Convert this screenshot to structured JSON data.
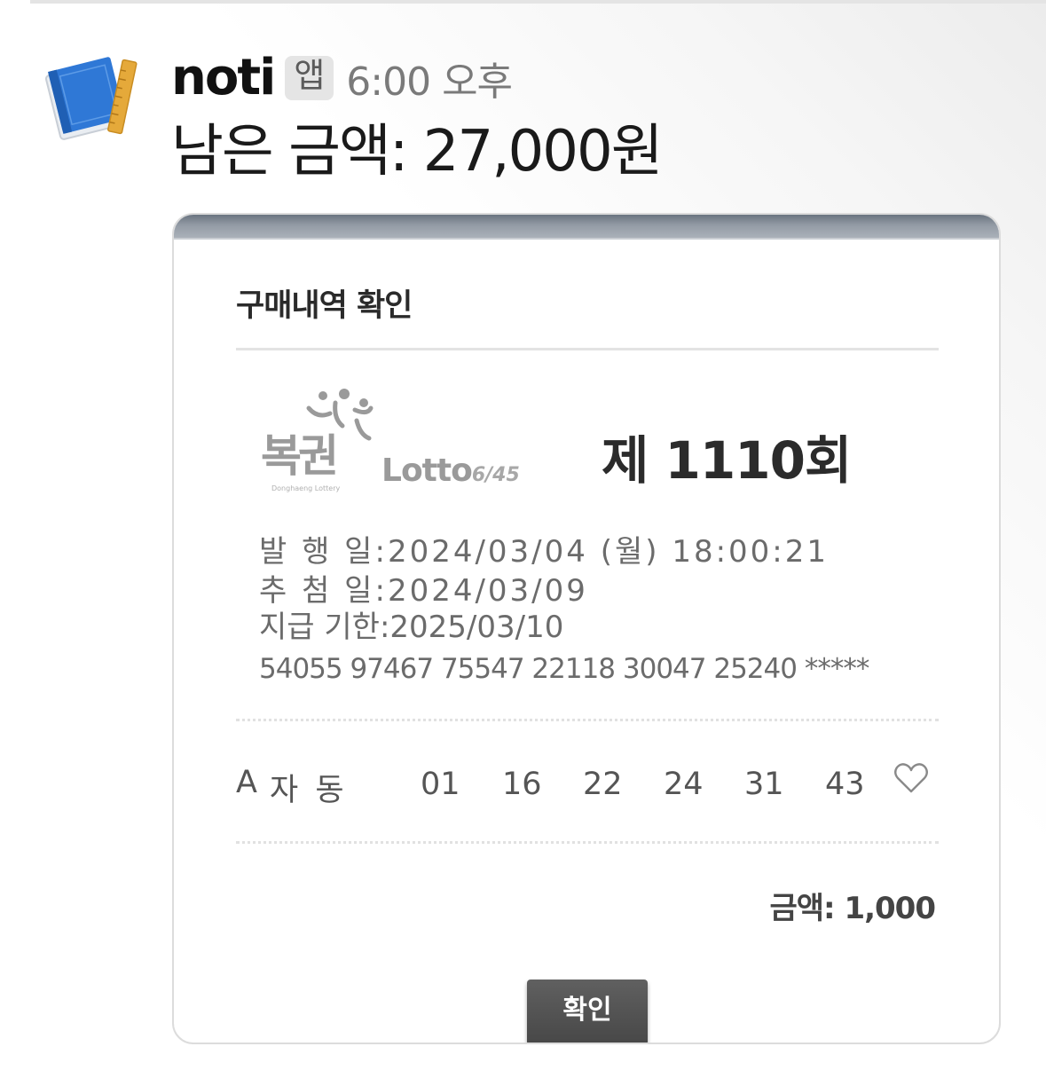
{
  "message": {
    "sender": "noti",
    "badge": "앱",
    "time": "6:00 오후",
    "text": "남은 금액: 27,000원"
  },
  "dialog": {
    "title": "구매내역 확인",
    "logo": {
      "korean": "복권",
      "english": "Donghaeng Lottery",
      "lotto": "Lotto",
      "game": "6/45"
    },
    "round": "제 1110회",
    "issue_label": "발 행 일",
    "issue_value": "2024/03/04 (월) 18:00:21",
    "draw_label": "추 첨 일",
    "draw_value": "2024/03/09",
    "pay_label": "지급 기한",
    "pay_value": "2025/03/10",
    "serial": "54055 97467 75547 22118 30047 25240 *****",
    "pick": {
      "slot": "A",
      "type": "자 동",
      "numbers": [
        "01",
        "16",
        "22",
        "24",
        "31",
        "43"
      ]
    },
    "amount": "금액: 1,000",
    "confirm_button": "확인"
  },
  "colors": {
    "logo_gray": "#9a9a9a",
    "button_bg": "#4f4f4f",
    "avatar_blue": "#2f78d6",
    "avatar_ruler": "#e5a93a"
  }
}
